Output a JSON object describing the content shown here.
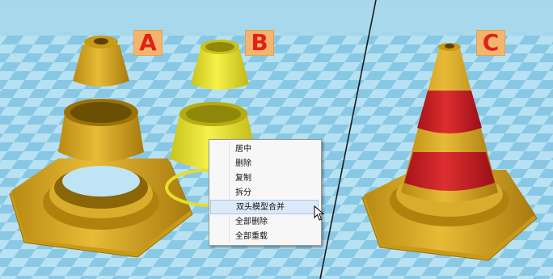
{
  "panels": {
    "a_label": "A",
    "b_label": "B",
    "c_label": "C"
  },
  "context_menu": {
    "items": [
      {
        "label": "居中"
      },
      {
        "label": "删除"
      },
      {
        "label": "复制"
      },
      {
        "label": "拆分"
      },
      {
        "label": "双头模型合并",
        "highlighted": true
      },
      {
        "label": "全部删除"
      },
      {
        "label": "全部重载"
      }
    ]
  },
  "colors": {
    "floor_light": "#b8e2f2",
    "floor_dark": "#84c6e4",
    "cone_yellow": "#e2b530",
    "cone_selected": "#f2ec3c",
    "stripe_red": "#d8282c",
    "label_bg": "#f3b56e",
    "label_text": "#e02218"
  }
}
